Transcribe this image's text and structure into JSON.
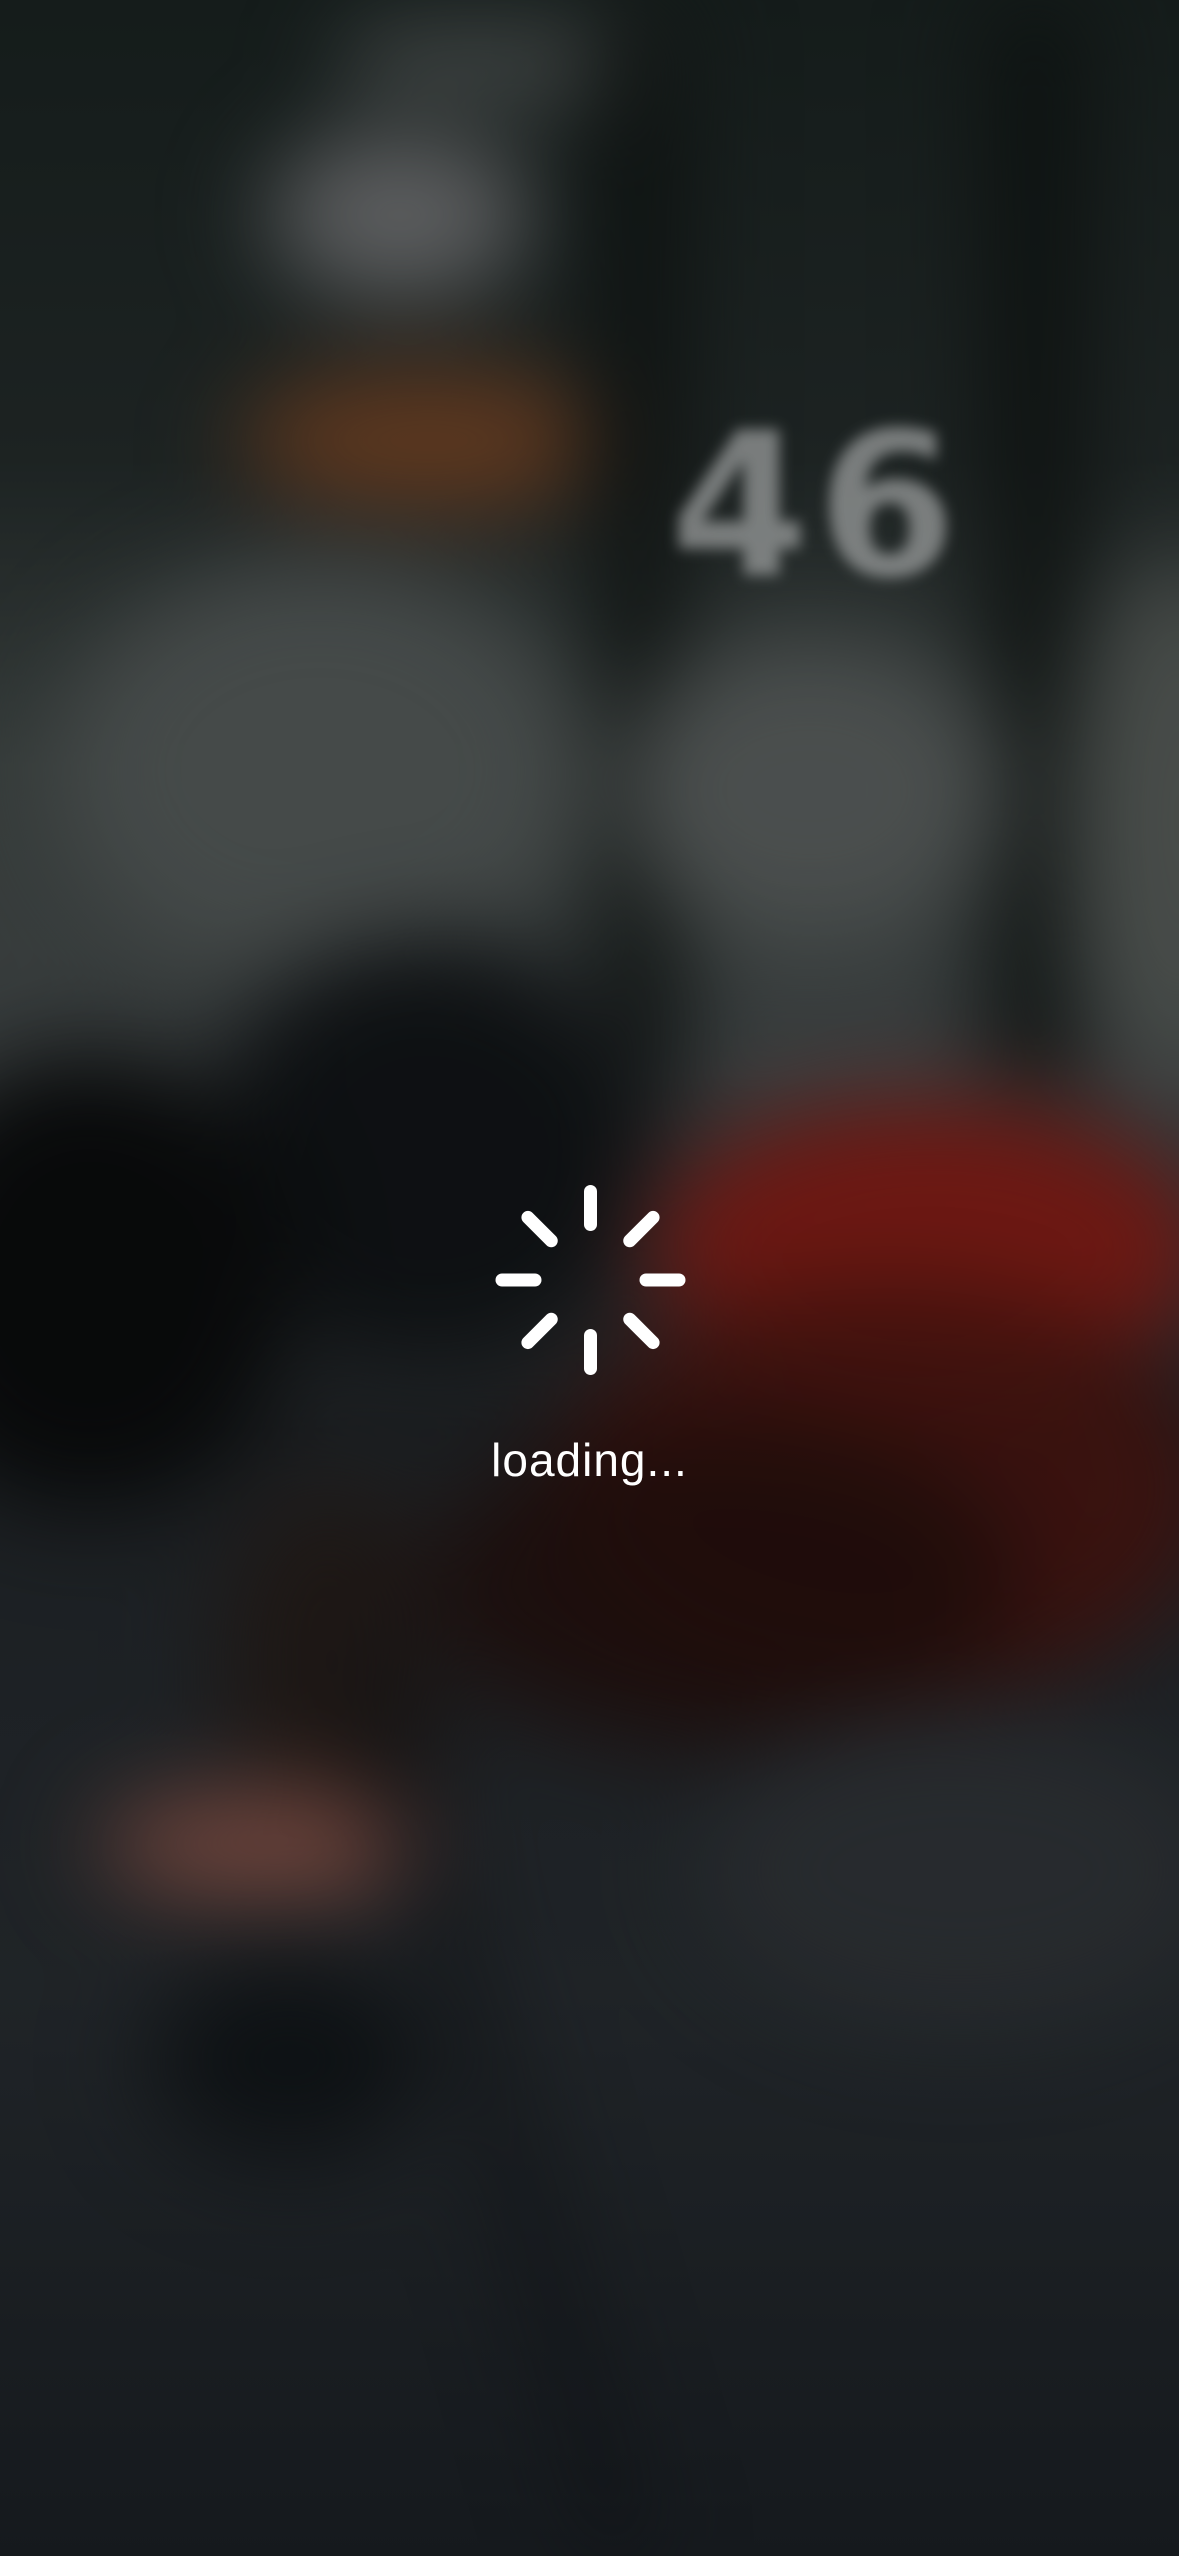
{
  "loader": {
    "text": "loading...",
    "icon": "spinner-icon",
    "color": "#ffffff"
  },
  "background": {
    "scoreboard_text": "46"
  }
}
